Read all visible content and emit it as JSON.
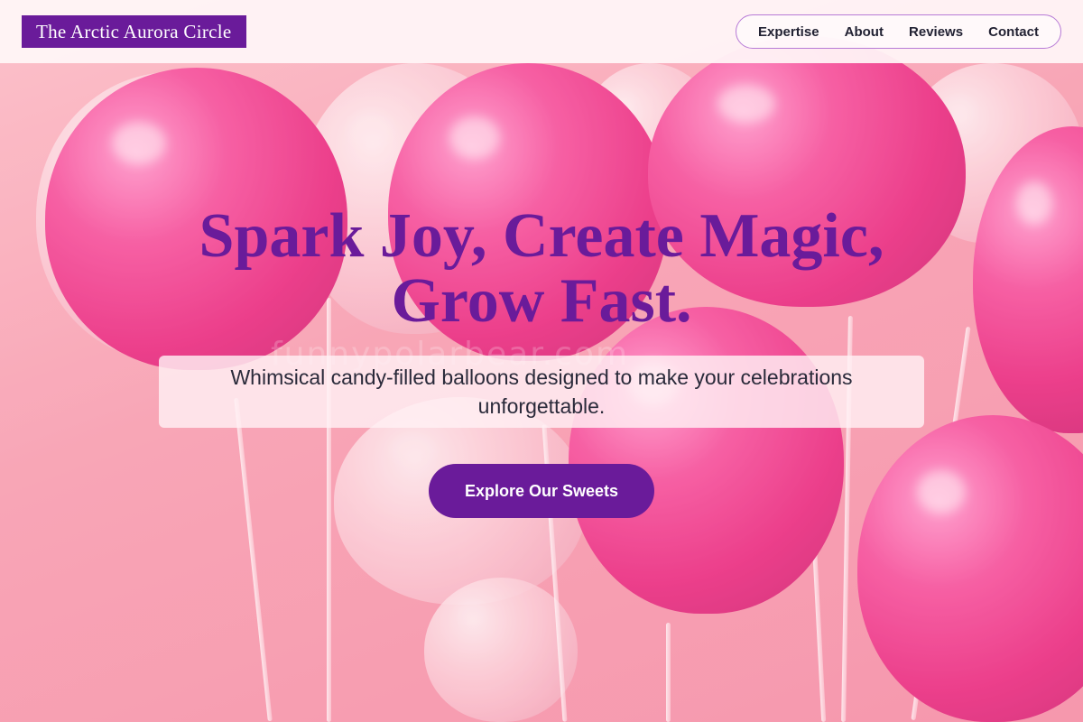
{
  "brand": {
    "name": "The Arctic Aurora Circle"
  },
  "nav": {
    "items": [
      {
        "label": "Expertise"
      },
      {
        "label": "About"
      },
      {
        "label": "Reviews"
      },
      {
        "label": "Contact"
      }
    ]
  },
  "hero": {
    "headline_line1": "Spark Joy, Create Magic,",
    "headline_line2": "Grow Fast.",
    "subtitle": "Whimsical candy-filled balloons designed to make your celebrations unforgettable.",
    "cta_label": "Explore Our Sweets",
    "watermark": "funnypolarbear.com"
  },
  "colors": {
    "brand_purple": "#6a1b9a",
    "balloon_pink": "#e8247e",
    "background_pink": "#f7a3b5"
  }
}
